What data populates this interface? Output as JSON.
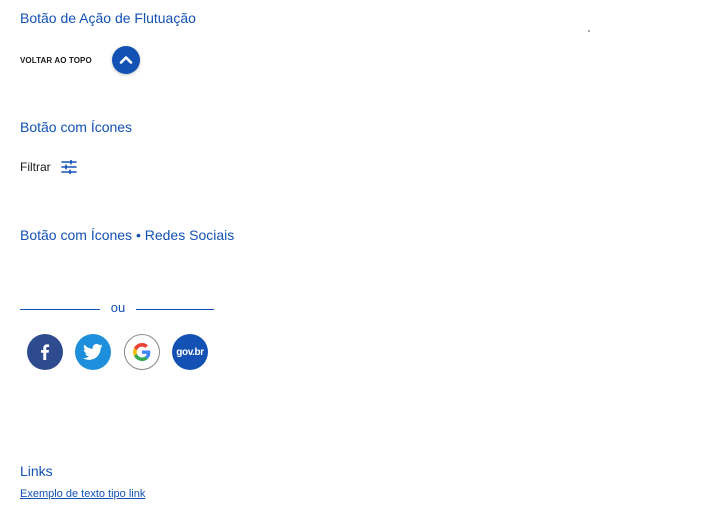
{
  "sections": {
    "fab_title": "Botão de Ação de Flutuação",
    "icon_button_title": "Botão com Ícones",
    "social_title": "Botão com Ícones • Redes Sociais",
    "links_title": "Links"
  },
  "back_to_top": {
    "label": "VOLTAR AO TOPO",
    "icon": "chevron-up-icon"
  },
  "filter_button": {
    "label": "Filtrar",
    "icon": "sliders-icon"
  },
  "social": {
    "divider_text": "ou",
    "buttons": [
      {
        "name": "facebook",
        "icon": "facebook-icon",
        "color": "#2d4b8e"
      },
      {
        "name": "twitter",
        "icon": "twitter-icon",
        "color": "#1d8fdc"
      },
      {
        "name": "google",
        "icon": "google-icon",
        "color": "#ffffff"
      },
      {
        "name": "gov.br",
        "icon": "govbr-icon",
        "label": "gov.br",
        "color": "#1351b4"
      }
    ]
  },
  "links": {
    "example_link": "Exemplo de texto tipo link"
  },
  "colors": {
    "primary": "#1351b4",
    "text": "#1b1b1b"
  }
}
